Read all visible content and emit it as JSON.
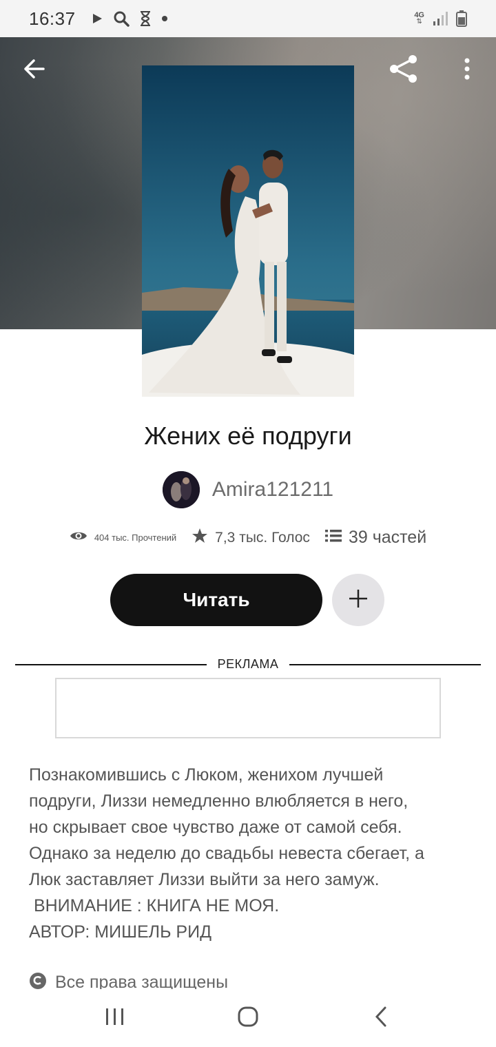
{
  "status_bar": {
    "time": "16:37",
    "network": "4G",
    "icons": [
      "play-icon",
      "search-icon",
      "hourglass-icon",
      "dot-icon",
      "signal-icon",
      "battery-icon"
    ]
  },
  "top_bar": {
    "back_icon": "arrow-left-icon",
    "share_icon": "share-icon",
    "more_icon": "more-vertical-icon"
  },
  "book": {
    "title": "Жених её подруги",
    "author": "Amira121211",
    "reads": "404 тыс. Прочтений",
    "votes": "7,3 тыс. Голос",
    "parts": "39 частей"
  },
  "actions": {
    "read_label": "Читать",
    "add_icon": "plus-icon"
  },
  "ad": {
    "label": "РЕКЛАМА"
  },
  "description": "Познакомившись с Люком, женихом лучшей\nподруги, Лиззи немедленно влюбляется в него,\nно скрывает свое чувство даже от самой себя.\nОднако за неделю до свадьбы невеста сбегает, а\nЛюк заставляет Лиззи выйти за него замуж.\n ВНИМАНИЕ : КНИГА НЕ МОЯ.\nАВТОР: МИШЕЛЬ РИД",
  "rights": {
    "text": "Все права защищены",
    "icon": "copyright-icon"
  },
  "colors": {
    "read_button": "#121212",
    "add_button": "#e4e3e6",
    "text_muted": "#555555"
  }
}
